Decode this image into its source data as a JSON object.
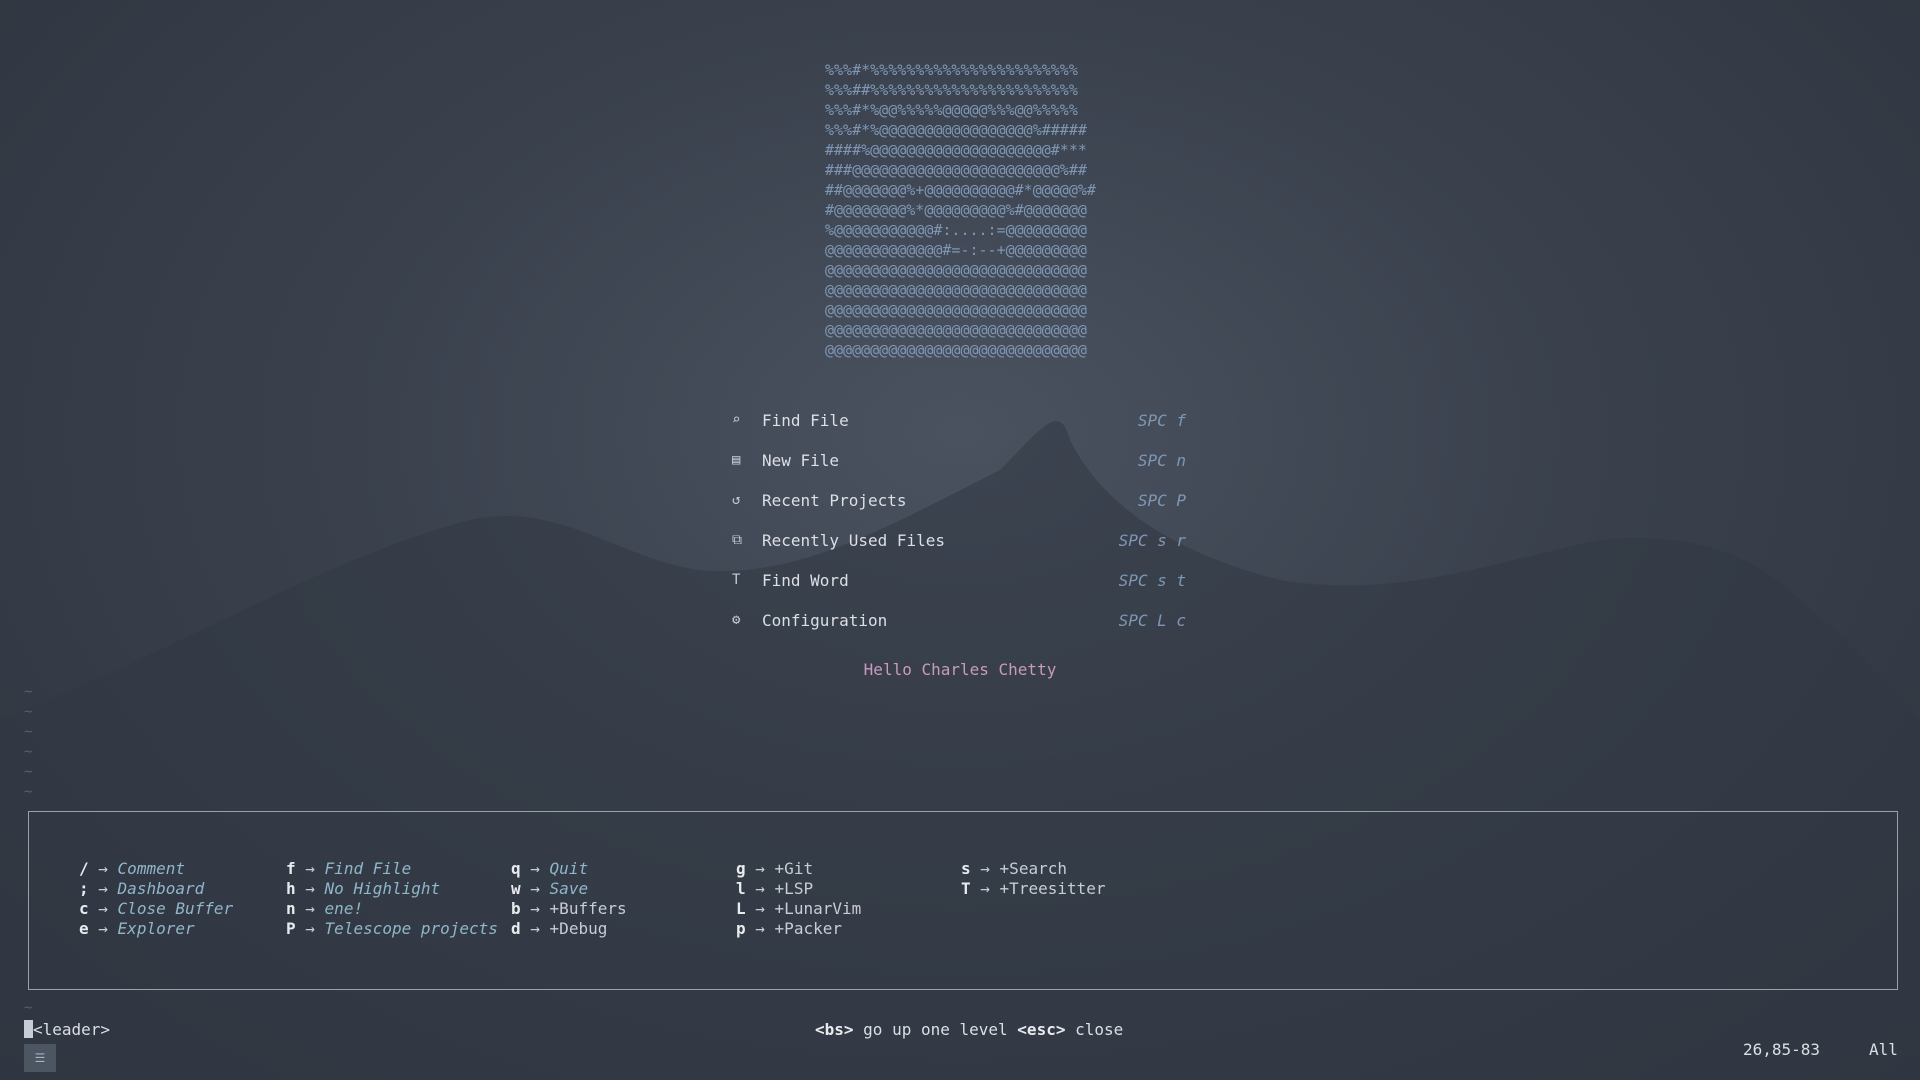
{
  "ascii_art": [
    "%%%#*%%%%%%%%%%%%%%%%%%%%%%%",
    "%%%##%%%%%%%%%%%%%%%%%%%%%%%",
    "%%%#*%@@%%%%%@@@@@%%%@@%%%%%",
    "%%%#*%@@@@@@@@@@@@@@@@@%#####",
    "####%@@@@@@@@@@@@@@@@@@@@#***",
    "###@@@@@@@@@@@@@@@@@@@@@@@%##",
    "##@@@@@@@%+@@@@@@@@@@#*@@@@@%#",
    "#@@@@@@@@%*@@@@@@@@@%#@@@@@@@",
    "%@@@@@@@@@@@#:....:=@@@@@@@@@",
    "@@@@@@@@@@@@@#=-:--+@@@@@@@@@",
    "@@@@@@@@@@@@@@@@@@@@@@@@@@@@@",
    "@@@@@@@@@@@@@@@@@@@@@@@@@@@@@",
    "@@@@@@@@@@@@@@@@@@@@@@@@@@@@@",
    "@@@@@@@@@@@@@@@@@@@@@@@@@@@@@",
    "@@@@@@@@@@@@@@@@@@@@@@@@@@@@@"
  ],
  "menu": [
    {
      "icon": "find-file-icon",
      "label": "Find File",
      "key": "SPC f"
    },
    {
      "icon": "new-file-icon",
      "label": "New File",
      "key": "SPC n"
    },
    {
      "icon": "history-icon",
      "label": "Recent Projects",
      "key": "SPC P"
    },
    {
      "icon": "files-icon",
      "label": "Recently Used Files",
      "key": "SPC s r"
    },
    {
      "icon": "text-icon",
      "label": "Find Word",
      "key": "SPC s t"
    },
    {
      "icon": "gear-icon",
      "label": "Configuration",
      "key": "SPC L c"
    }
  ],
  "greeting": "Hello Charles Chetty",
  "which_key": {
    "columns": [
      [
        {
          "key": "/",
          "cmd": "Comment",
          "group": false
        },
        {
          "key": ";",
          "cmd": "Dashboard",
          "group": false
        },
        {
          "key": "c",
          "cmd": "Close Buffer",
          "group": false
        },
        {
          "key": "e",
          "cmd": "Explorer",
          "group": false
        }
      ],
      [
        {
          "key": "f",
          "cmd": "Find File",
          "group": false
        },
        {
          "key": "h",
          "cmd": "No Highlight",
          "group": false
        },
        {
          "key": "n",
          "cmd": "ene!",
          "group": false
        },
        {
          "key": "P",
          "cmd": "Telescope projects",
          "group": false
        }
      ],
      [
        {
          "key": "q",
          "cmd": "Quit",
          "group": false
        },
        {
          "key": "w",
          "cmd": "Save",
          "group": false
        },
        {
          "key": "b",
          "cmd": "+Buffers",
          "group": true
        },
        {
          "key": "d",
          "cmd": "+Debug",
          "group": true
        }
      ],
      [
        {
          "key": "g",
          "cmd": "+Git",
          "group": true
        },
        {
          "key": "l",
          "cmd": "+LSP",
          "group": true
        },
        {
          "key": "L",
          "cmd": "+LunarVim",
          "group": true
        },
        {
          "key": "p",
          "cmd": "+Packer",
          "group": true
        }
      ],
      [
        {
          "key": "s",
          "cmd": "+Search",
          "group": true
        },
        {
          "key": "T",
          "cmd": "+Treesitter",
          "group": true
        }
      ]
    ],
    "arrow": "→"
  },
  "status": {
    "leader": "<leader>",
    "hint_bs": "<bs>",
    "hint_bs_text": " go up one level ",
    "hint_esc": "<esc>",
    "hint_esc_text": " close",
    "position": "26,85-83",
    "scroll": "All",
    "corner_label": "☰"
  },
  "colors": {
    "ascii": "#7f97b4",
    "greeting": "#c79bbd",
    "shortcut": "#7f97b4",
    "command": "#8fb6c9"
  }
}
